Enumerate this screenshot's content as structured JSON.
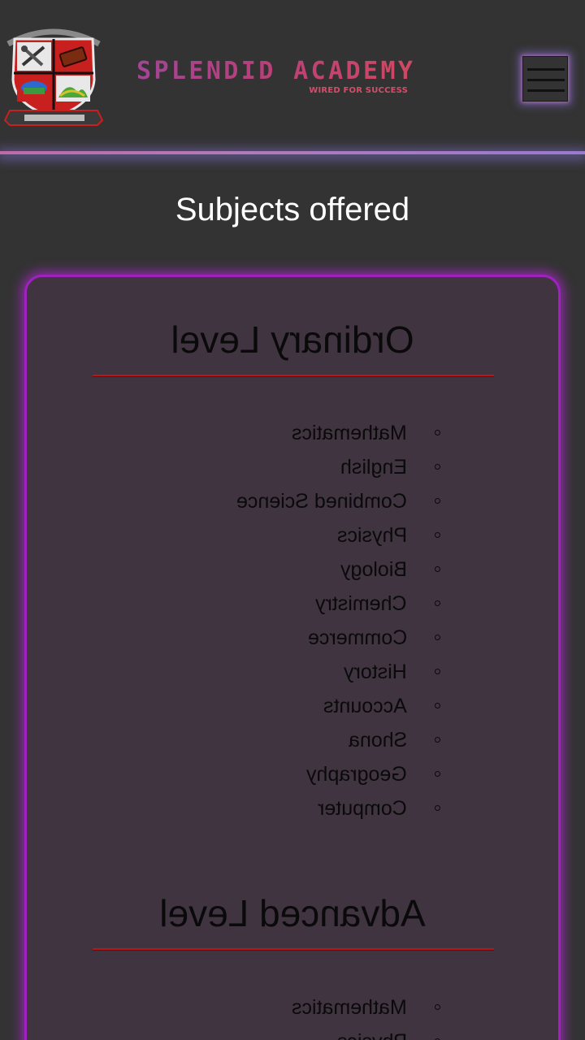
{
  "header": {
    "brand_name": "SPLENDID ACADEMY",
    "brand_tagline": "WIRED FOR SUCCESS",
    "logo_colors": {
      "shield_red": "#c8201e",
      "shield_outline": "#ffffff",
      "banner": "#d8d8d8"
    },
    "menu_icon": "hamburger-icon",
    "glow_color": "#9a7ad0"
  },
  "page_title": "Subjects offered",
  "sections": [
    {
      "title": "Ordinary Level",
      "subjects": [
        "Mathematics",
        "English",
        "Combined Science",
        "Physics",
        "Biology",
        "Chemistry",
        "Commerce",
        "History",
        "Accounts",
        "Shona",
        "Geography",
        "Computer"
      ]
    },
    {
      "title": "Advanced Level",
      "subjects": [
        "Mathematics",
        "Physics"
      ]
    }
  ],
  "colors": {
    "background": "#333333",
    "card": "#403440",
    "card_border": "#a020c0",
    "rule": "#c01414",
    "brand_gradient_start": "#a24596",
    "brand_gradient_end": "#d04862"
  }
}
